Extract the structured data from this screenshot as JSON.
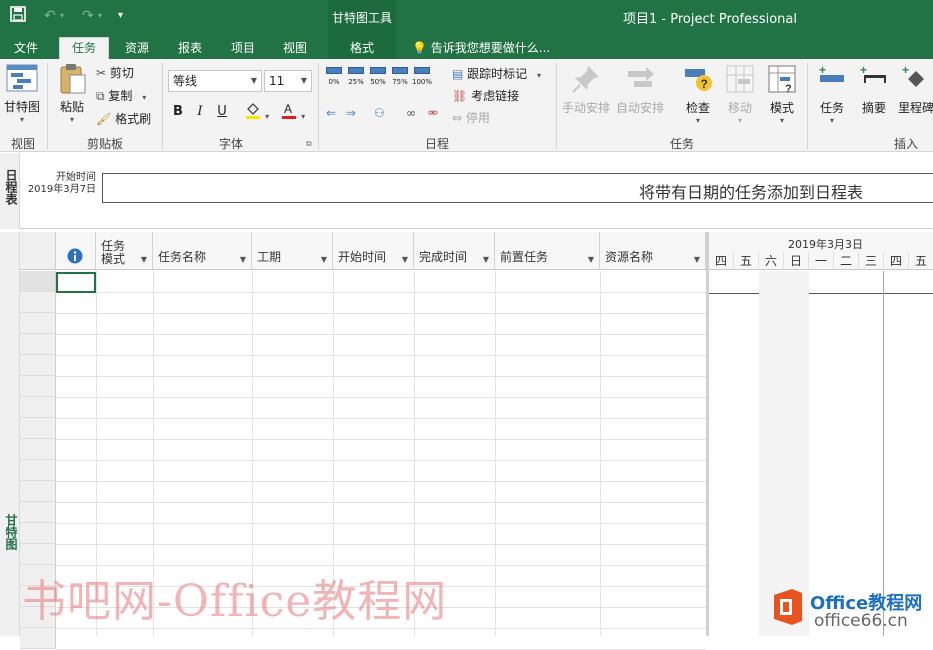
{
  "titlebar": {
    "app_title": "项目1 - Project Professional",
    "context_tool": "甘特图工具",
    "save_icon": "save-icon",
    "undo_icon": "undo-icon",
    "redo_icon": "redo-icon",
    "customize_icon": "chevron-down-icon"
  },
  "tabs": {
    "file": "文件",
    "task": "任务",
    "resource": "资源",
    "report": "报表",
    "project": "项目",
    "view": "视图",
    "format": "格式",
    "tell_me": "告诉我您想要做什么..."
  },
  "ribbon": {
    "view_group": {
      "label": "视图",
      "gantt": "甘特图"
    },
    "clipboard_group": {
      "label": "剪贴板",
      "paste": "粘贴",
      "cut": "剪切",
      "copy": "复制",
      "format_painter": "格式刷"
    },
    "font_group": {
      "label": "字体",
      "font_name": "等线",
      "font_size": "11",
      "bold": "B",
      "italic": "I",
      "underline": "U"
    },
    "schedule_group": {
      "label": "日程",
      "percents": [
        "0%",
        "25%",
        "50%",
        "75%",
        "100%"
      ],
      "track": "跟踪时标记",
      "respect_links": "考虑链接",
      "inactivate": "停用"
    },
    "tasks_group": {
      "label": "任务",
      "manual": "手动安排",
      "auto": "自动安排",
      "inspect": "检查",
      "move": "移动",
      "mode": "模式"
    },
    "insert_group": {
      "label": "插入",
      "task": "任务",
      "summary": "摘要",
      "milestone": "里程碑"
    }
  },
  "timeline": {
    "side_label": "日程表",
    "start_label": "开始时间",
    "start_date": "2019年3月7日",
    "placeholder": "将带有日期的任务添加到日程表"
  },
  "gantt": {
    "side_label": "甘特图",
    "columns": {
      "task_mode_line1": "任务",
      "task_mode_line2": "模式",
      "task_name": "任务名称",
      "duration": "工期",
      "start": "开始时间",
      "finish": "完成时间",
      "predecessors": "前置任务",
      "resource_names": "资源名称"
    },
    "week_label": "2019年3月3日",
    "days": [
      "四",
      "五",
      "六",
      "日",
      "一",
      "二",
      "三",
      "四",
      "五"
    ]
  },
  "watermark": {
    "text": "书吧网-Office教程网",
    "logo_text": "Office教程网",
    "logo_url_text": "office66.cn"
  },
  "colors": {
    "accent": "#217346",
    "today_line": "#8fbc8f"
  }
}
